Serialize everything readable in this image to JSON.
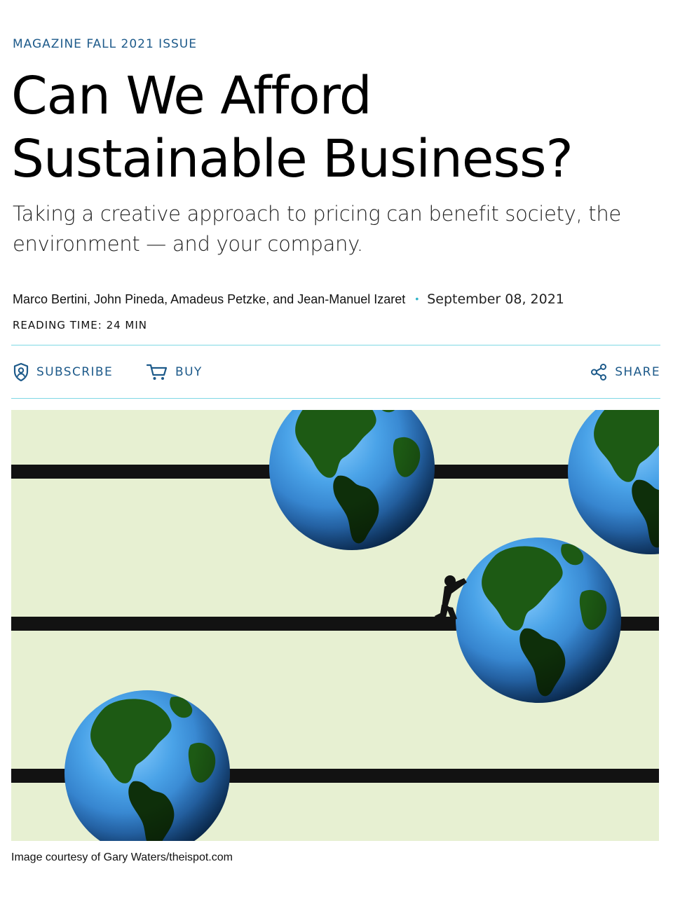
{
  "article": {
    "kicker": "MAGAZINE FALL 2021 ISSUE",
    "title": "Can We Afford Sustainable Business?",
    "dek": "Taking a creative approach to pricing can benefit society, the environment — and your company.",
    "authors": "Marco Bertini, John Pineda, Amadeus Petzke, and Jean-Manuel Izaret",
    "separator": "•",
    "date": "September 08, 2021",
    "reading_time": "READING TIME: 24 MIN"
  },
  "actions": {
    "subscribe_label": "SUBSCRIBE",
    "buy_label": "BUY",
    "share_label": "SHARE"
  },
  "hero": {
    "caption": "Image courtesy of Gary Waters/theispot.com"
  },
  "colors": {
    "accent_blue": "#1d5a8a",
    "rule_cyan": "#7fd8e4",
    "illustration_background": "#e7f0d2",
    "rod": "#121212"
  },
  "icons": {
    "subscribe": "shield-user-icon",
    "buy": "shopping-cart-icon",
    "share": "share-nodes-icon"
  }
}
